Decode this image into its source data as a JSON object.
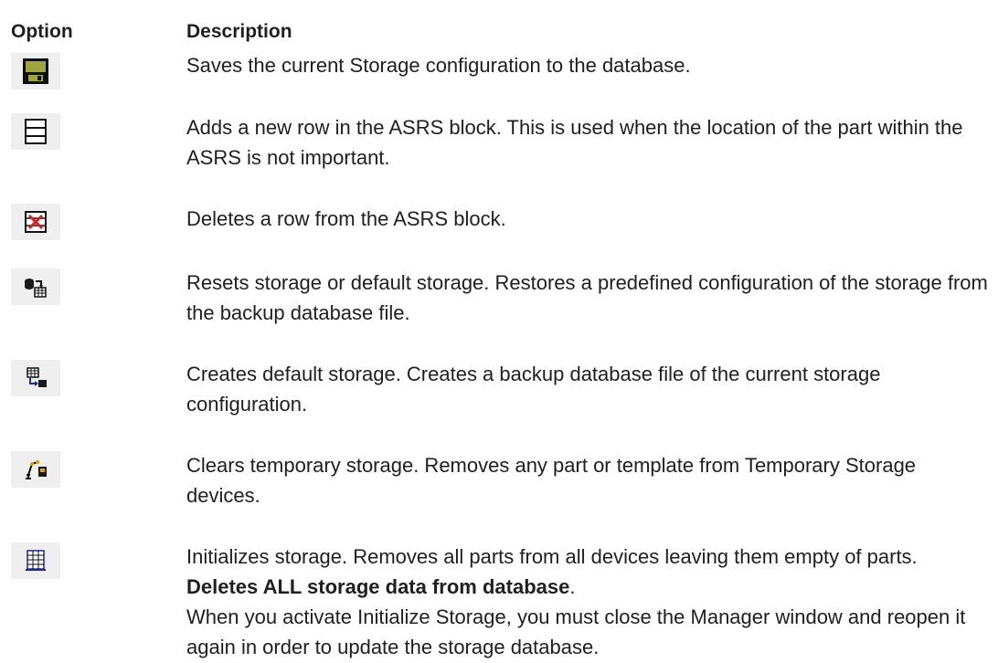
{
  "table": {
    "headers": {
      "option": "Option",
      "description": "Description"
    },
    "rows": [
      {
        "icon": "save-icon",
        "description": "Saves the current Storage configuration to the database."
      },
      {
        "icon": "add-row-icon",
        "description": "Adds a new row in the ASRS block. This is used when the location of the part within the ASRS is not important."
      },
      {
        "icon": "delete-row-icon",
        "description": "Deletes a row from the ASRS block."
      },
      {
        "icon": "reset-storage-icon",
        "description": "Resets storage or default storage. Restores a predefined configuration of the storage from the backup database file."
      },
      {
        "icon": "create-default-storage-icon",
        "description": "Creates default storage. Creates a backup database file of the current storage configuration."
      },
      {
        "icon": "clear-temporary-storage-icon",
        "description": "Clears temporary storage. Removes any part or template from Temporary Storage devices."
      },
      {
        "icon": "initialize-storage-icon",
        "description_prefix": "Initializes storage. Removes all parts from all devices leaving them empty of parts. ",
        "description_bold": "Deletes ALL storage data from database",
        "description_suffix": "."
      }
    ],
    "note": "When you activate Initialize Storage, you must close the Manager window and reopen it again in order to update the storage database."
  },
  "colors": {
    "icon_bg": "#efefef",
    "save_green": "#9fa63b",
    "save_dark": "#0d0d0d",
    "delete_red": "#d91f1f",
    "initialize_blue": "#1f2b8f"
  }
}
